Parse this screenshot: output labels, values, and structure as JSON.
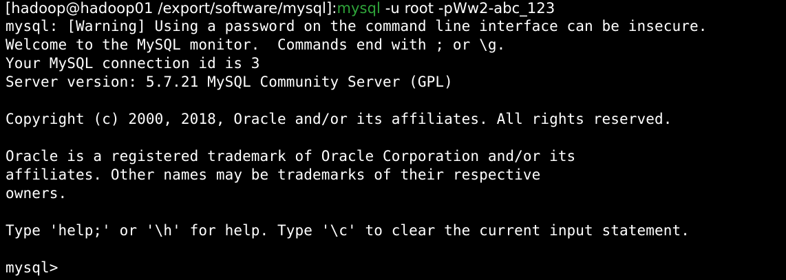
{
  "terminal": {
    "prompt": {
      "user_host_path": "[hadoop@hadoop01 /export/software/mysql]:",
      "command": "mysql",
      "args": " -u root -pWw2-abc_123"
    },
    "lines": [
      "mysql: [Warning] Using a password on the command line interface can be insecure.",
      "Welcome to the MySQL monitor.  Commands end with ; or \\g.",
      "Your MySQL connection id is 3",
      "Server version: 5.7.21 MySQL Community Server (GPL)",
      "",
      "Copyright (c) 2000, 2018, Oracle and/or its affiliates. All rights reserved.",
      "",
      "Oracle is a registered trademark of Oracle Corporation and/or its",
      "affiliates. Other names may be trademarks of their respective",
      "owners.",
      "",
      "Type 'help;' or '\\h' for help. Type '\\c' to clear the current input statement.",
      ""
    ],
    "mysql_prompt": "mysql>"
  },
  "colors": {
    "background": "#000000",
    "text": "#ffffff",
    "command_highlight": "#2fa53a"
  }
}
